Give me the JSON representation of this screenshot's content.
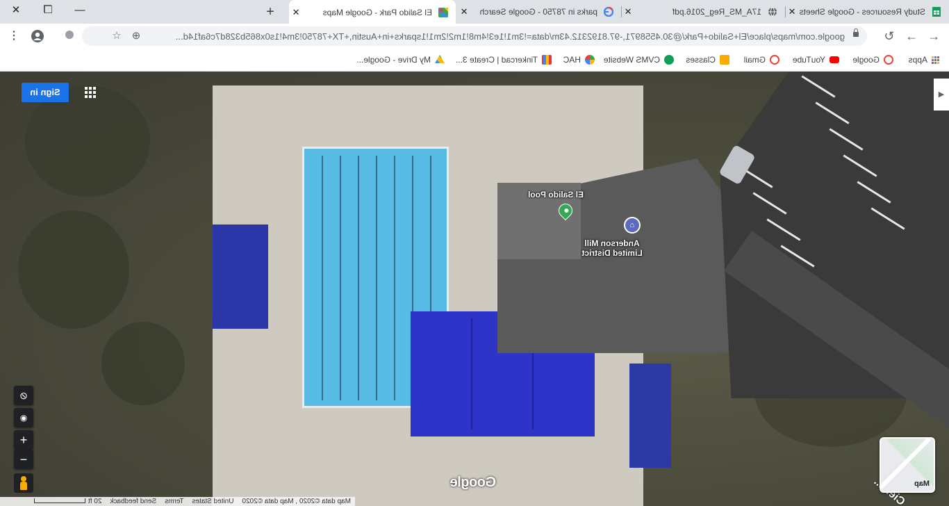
{
  "browser": {
    "tabs": [
      {
        "title": "Study Resources - Google Sheets",
        "favicon": "sheets-icon",
        "color": "#0f9d58",
        "active": false
      },
      {
        "title": "17A_MS_Reg_2016.pdf",
        "favicon": "globe-icon",
        "color": "#5f6368",
        "active": false
      },
      {
        "title": "parks in 78750 - Google Search",
        "favicon": "google-icon",
        "color": "#4285f4",
        "active": false
      },
      {
        "title": "El Salido Park - Google Maps",
        "favicon": "maps-icon",
        "color": "#34a853",
        "active": true
      }
    ],
    "new_tab_label": "+",
    "url": "google.com/maps/place/El+Salido+Park/@30.4558971,-97.8192312.43m/data=!3m1!1e3!4m8!1m2!2m1!1sparks+in+Austin,+TX+78750!3m4!1s0x865b328d7c6af14d..."
  },
  "bookmarks": [
    {
      "label": "Apps",
      "icon": "apps-grid-icon",
      "color": "#4285f4"
    },
    {
      "label": "Google",
      "icon": "google-icon",
      "color": "#ea4335"
    },
    {
      "label": "YouTube",
      "icon": "youtube-icon",
      "color": "#ff0000"
    },
    {
      "label": "Gmail",
      "icon": "google-icon",
      "color": "#ea4335"
    },
    {
      "label": "Classes",
      "icon": "classroom-icon",
      "color": "#f9ab00"
    },
    {
      "label": "CVMS Website",
      "icon": "cvms-icon",
      "color": "#0f9d58"
    },
    {
      "label": "HAC",
      "icon": "hac-icon",
      "color": "#7b1fa2"
    },
    {
      "label": "Tinkercad | Create 3...",
      "icon": "tinkercad-icon",
      "color": "#e53935"
    },
    {
      "label": "My Drive - Google...",
      "icon": "drive-icon",
      "color": "#fbbc04"
    }
  ],
  "map": {
    "sign_in_label": "Sign in",
    "places": [
      {
        "name": "El Salido Pool",
        "icon": "place-pin-icon",
        "color": "#34a853"
      },
      {
        "name": "Anderson Mill Limited District",
        "icon": "government-building-icon",
        "color": "#5c6bc0"
      }
    ],
    "road_label": "Cielo...",
    "layer_toggle_label": "Map",
    "brand_watermark": "Google",
    "zoom_in_label": "+",
    "zoom_out_label": "−",
    "footer": {
      "map_data": "Map data ©2020 , Map data ©2020",
      "region": "United States",
      "terms": "Terms",
      "feedback": "Send feedback",
      "scale": "20 ft"
    }
  }
}
